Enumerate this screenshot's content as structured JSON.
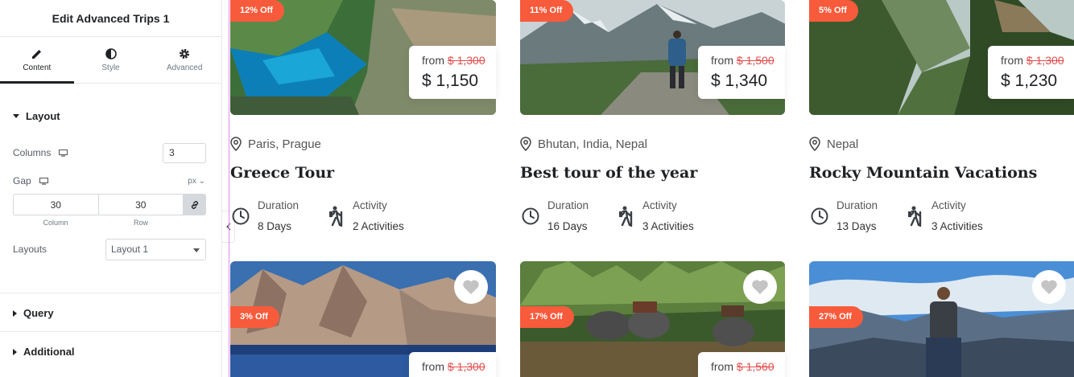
{
  "panel": {
    "title": "Edit Advanced Trips 1",
    "tabs": [
      {
        "label": "Content",
        "icon": "pencil-icon",
        "active": true
      },
      {
        "label": "Style",
        "icon": "half-circle-icon",
        "active": false
      },
      {
        "label": "Advanced",
        "icon": "gear-icon",
        "active": false
      }
    ],
    "layout_section": "Layout",
    "columns_label": "Columns",
    "columns_value": "3",
    "gap_label": "Gap",
    "gap_unit": "px",
    "gap_column_value": "30",
    "gap_row_value": "30",
    "gap_column_label": "Column",
    "gap_row_label": "Row",
    "layouts_label": "Layouts",
    "layouts_value": "Layout 1",
    "query_section": "Query",
    "additional_section": "Additional"
  },
  "colors": {
    "badge": "#f75b3b",
    "old_price": "#e44d4d",
    "accent": "#1f2124"
  },
  "trips": [
    {
      "discount": "12% Off",
      "price_from": "from",
      "old_price": "$ 1,300",
      "new_price": "$ 1,150",
      "location": "Paris,  Prague",
      "title": "Greece Tour",
      "duration_label": "Duration",
      "duration": "8  Days",
      "activity_label": "Activity",
      "activities": "2 Activities"
    },
    {
      "discount": "11% Off",
      "price_from": "from",
      "old_price": "$ 1,500",
      "new_price": "$ 1,340",
      "location": "Bhutan,  India,  Nepal",
      "title": "Best tour of the year",
      "duration_label": "Duration",
      "duration": "16  Days",
      "activity_label": "Activity",
      "activities": "3 Activities"
    },
    {
      "discount": "5% Off",
      "price_from": "from",
      "old_price": "$ 1,300",
      "new_price": "$ 1,230",
      "location": "Nepal",
      "title": "Rocky Mountain Vacations",
      "duration_label": "Duration",
      "duration": "13  Days",
      "activity_label": "Activity",
      "activities": "3 Activities"
    }
  ],
  "trips_row2": [
    {
      "discount": "3% Off",
      "price_from": "from",
      "old_price": "$ 1,300"
    },
    {
      "discount": "17% Off",
      "price_from": "from",
      "old_price": "$ 1,560"
    },
    {
      "discount": "27% Off"
    }
  ]
}
